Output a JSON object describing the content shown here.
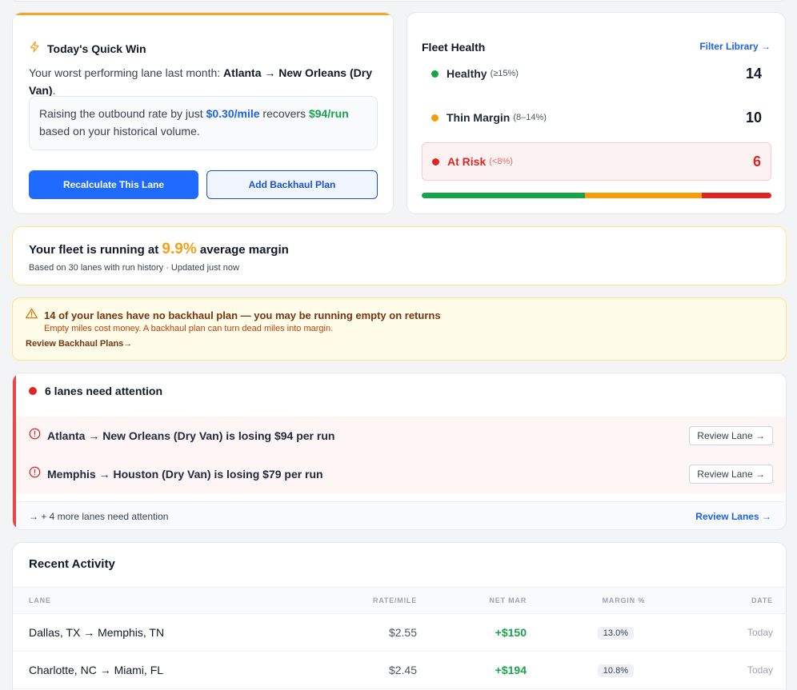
{
  "quick_win": {
    "title": "Today's Quick Win",
    "icon": "lightning-icon",
    "intro": "Your worst performing lane last month: ",
    "lane": "Atlanta → New Orleans (Dry Van)",
    "intro_end": ".",
    "box_pre": "Raising the outbound rate by just ",
    "box_rate": "$0.30/mile",
    "box_mid": " recovers ",
    "box_recovers": "$94/run",
    "box_post": " based on your historical volume.",
    "primary_button": "Recalculate This Lane",
    "secondary_button": "Add Backhaul Plan"
  },
  "fleet_health": {
    "title": "Fleet Health",
    "link": "Filter Library →",
    "rows": [
      {
        "label": "Healthy",
        "range": "(≥15%)",
        "count": "14",
        "color": "#16a34a"
      },
      {
        "label": "Thin Margin",
        "range": "(8–14%)",
        "count": "10",
        "color": "#f59e0b"
      },
      {
        "label": "At Risk",
        "range": "(<8%)",
        "count": "6",
        "color": "#dc2626"
      }
    ],
    "bar": [
      {
        "fraction": 0.4667,
        "color": "#16a34a"
      },
      {
        "fraction": 0.3333,
        "color": "#f59e0b"
      },
      {
        "fraction": 0.2,
        "color": "#dc2626"
      }
    ]
  },
  "margin_banner": {
    "pre": "Your fleet is running at ",
    "value": "9.9%",
    "post": " average margin",
    "sub": "Based on 30 lanes with run history · Updated just now"
  },
  "warning": {
    "icon": "warning-triangle-icon",
    "title": "14 of your lanes have no backhaul plan — you may be running empty on returns",
    "sub": "Empty miles cost money. A backhaul plan can turn dead miles into margin.",
    "link": "Review Backhaul Plans→"
  },
  "attention": {
    "title": "6 lanes need attention",
    "items": [
      {
        "text": "Atlanta → New Orleans (Dry Van) is losing $94 per run",
        "button": "Review Lane →"
      },
      {
        "text": "Memphis → Houston (Dry Van) is losing $79 per run",
        "button": "Review Lane →"
      }
    ],
    "more": "→ + 4 more lanes need attention",
    "review_all": "Review Lanes →"
  },
  "activity": {
    "title": "Recent Activity",
    "columns": {
      "lane": "LANE",
      "rate": "RATE/MILE",
      "net": "NET MAR",
      "pct": "MARGIN %",
      "date": "DATE"
    },
    "rows": [
      {
        "lane": "Dallas, TX → Memphis, TN",
        "rate": "$2.55",
        "net": "+$150",
        "pct": "13.0%",
        "date": "Today"
      },
      {
        "lane": "Charlotte, NC → Miami, FL",
        "rate": "$2.45",
        "net": "+$194",
        "pct": "10.8%",
        "date": "Today"
      }
    ]
  }
}
